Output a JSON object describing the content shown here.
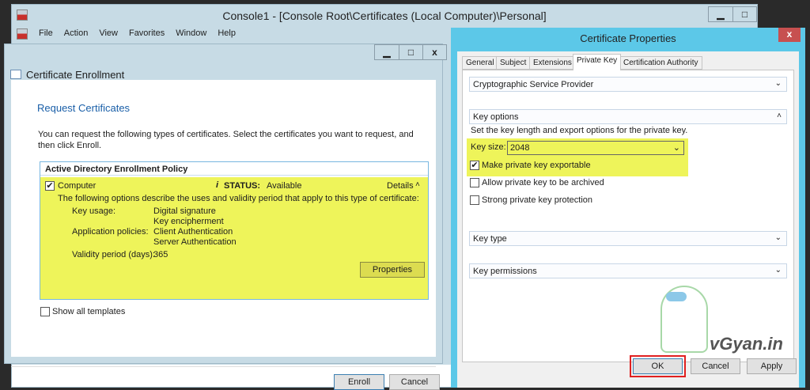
{
  "console": {
    "title": "Console1 - [Console Root\\Certificates (Local Computer)\\Personal]",
    "menu": [
      "File",
      "Action",
      "View",
      "Favorites",
      "Window",
      "Help"
    ]
  },
  "window_buttons": {
    "minimize": "▁",
    "maximize": "□",
    "close": "x"
  },
  "enrollment": {
    "title": "Certificate Enrollment",
    "heading": "Request Certificates",
    "intro": "You can request the following types of certificates. Select the certificates you want to request, and then click Enroll.",
    "policy": "Active Directory Enrollment Policy",
    "cert": {
      "name": "Computer",
      "checked": true,
      "status_label": "STATUS:",
      "status": "Available",
      "details": "Details",
      "description": "The following options describe the uses and validity period that apply to this type of certificate:",
      "key_usage_label": "Key usage:",
      "key_usage": [
        "Digital signature",
        "Key encipherment"
      ],
      "app_policies_label": "Application policies:",
      "app_policies": [
        "Client Authentication",
        "Server Authentication"
      ],
      "validity_label": "Validity period (days):",
      "validity": "365",
      "properties_button": "Properties"
    },
    "show_all": "Show all templates",
    "show_all_checked": false,
    "enroll_button": "Enroll",
    "cancel_button": "Cancel"
  },
  "properties": {
    "title": "Certificate Properties",
    "close": "x",
    "tabs": [
      "General",
      "Subject",
      "Extensions",
      "Private Key",
      "Certification Authority"
    ],
    "active_tab": "Private Key",
    "sections": {
      "csp": "Cryptographic Service Provider",
      "key_options": "Key options",
      "key_type": "Key type",
      "key_permissions": "Key permissions"
    },
    "key_options_desc": "Set the key length and export options for the private key.",
    "key_size_label": "Key size:",
    "key_size": "2048",
    "exportable": "Make private key exportable",
    "exportable_checked": true,
    "archive": "Allow private key to be archived",
    "archive_checked": false,
    "strong": "Strong private key protection",
    "strong_checked": false,
    "ok": "OK",
    "cancel": "Cancel",
    "apply": "Apply",
    "watermark": "vGyan.in"
  },
  "colors": {
    "highlight": "#eef45a",
    "accent": "#5cc8e8",
    "ok_outline": "#e02020",
    "link_blue": "#1a5fa8"
  }
}
